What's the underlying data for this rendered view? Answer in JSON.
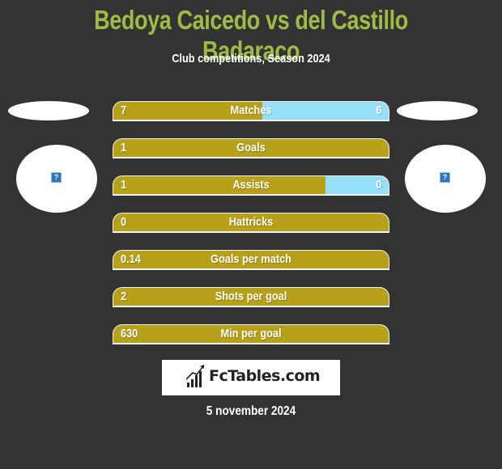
{
  "header": {
    "title": "Bedoya Caicedo vs del Castillo Badaraco",
    "subtitle": "Club competitions, Season 2024"
  },
  "players": {
    "left": {
      "image_icon": "broken-image-icon",
      "placeholder_glyph": "?"
    },
    "right": {
      "image_icon": "broken-image-icon",
      "placeholder_glyph": "?"
    }
  },
  "colors": {
    "title": "#9dbb45",
    "left_bar": "#b8a11a",
    "right_bar": "#95e0f8",
    "background": "#333333"
  },
  "stats": [
    {
      "label": "Matches",
      "left": "7",
      "right": "6",
      "left_share": 0.54
    },
    {
      "label": "Goals",
      "left": "1",
      "right": "",
      "left_share": 1.0
    },
    {
      "label": "Assists",
      "left": "1",
      "right": "0",
      "left_share": 0.77
    },
    {
      "label": "Hattricks",
      "left": "0",
      "right": "",
      "left_share": 1.0
    },
    {
      "label": "Goals per match",
      "left": "0.14",
      "right": "",
      "left_share": 1.0
    },
    {
      "label": "Shots per goal",
      "left": "2",
      "right": "",
      "left_share": 1.0
    },
    {
      "label": "Min per goal",
      "left": "630",
      "right": "",
      "left_share": 1.0
    }
  ],
  "footer": {
    "logo_text": "FcTables.com",
    "logo_icon": "bar-chart-icon",
    "date": "5 november 2024"
  }
}
